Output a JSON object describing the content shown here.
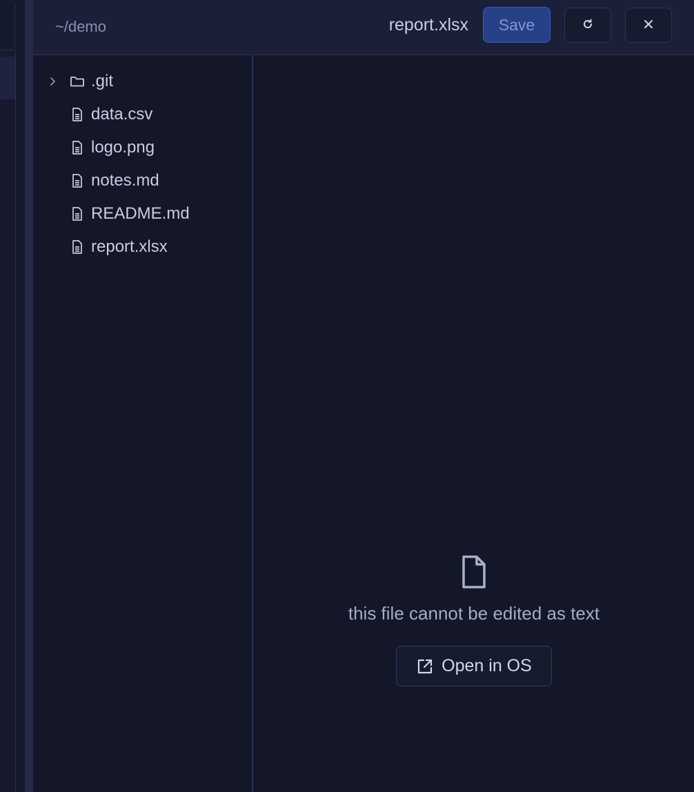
{
  "header": {
    "path": "~/demo",
    "filename": "report.xlsx",
    "save_label": "Save",
    "reload_icon": "reload-icon",
    "close_icon": "close-icon"
  },
  "tree": {
    "items": [
      {
        "label": ".git",
        "type": "folder",
        "expandable": true
      },
      {
        "label": "data.csv",
        "type": "file"
      },
      {
        "label": "logo.png",
        "type": "file"
      },
      {
        "label": "notes.md",
        "type": "file"
      },
      {
        "label": "README.md",
        "type": "file"
      },
      {
        "label": "report.xlsx",
        "type": "file"
      }
    ]
  },
  "content": {
    "empty_message": "this file cannot be edited as text",
    "open_button_label": "Open in OS",
    "file_icon": "file-icon",
    "open_icon": "external-link-icon"
  },
  "colors": {
    "background": "#131728",
    "header": "#192038",
    "save_button": "#26408a",
    "text": "#c9cde0",
    "muted": "#8a91ad"
  }
}
